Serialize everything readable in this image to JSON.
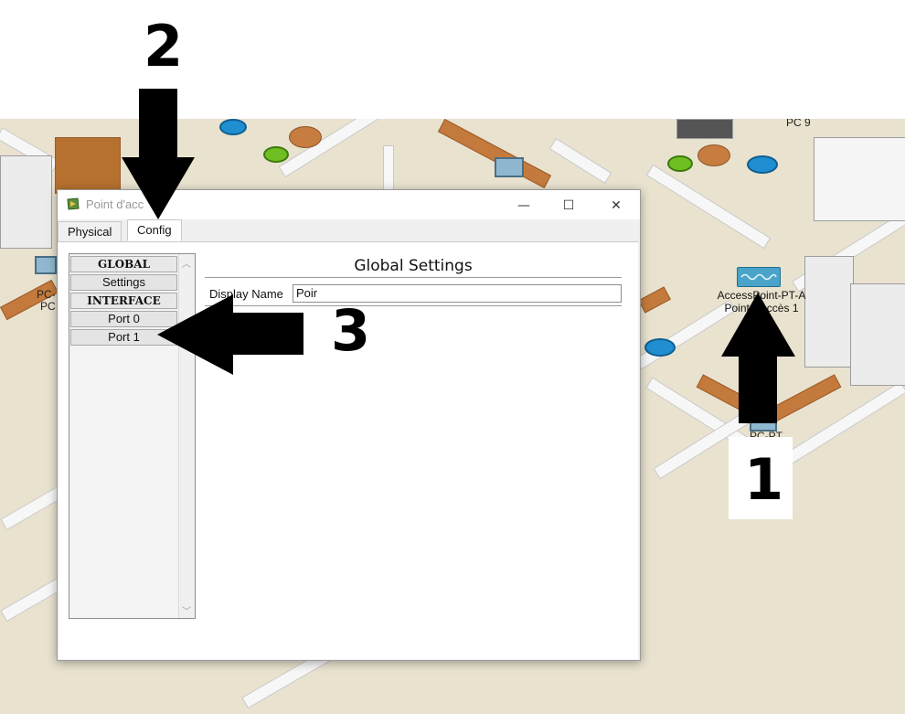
{
  "annotations": {
    "step1": "1",
    "step2": "2",
    "step3": "3"
  },
  "workspace": {
    "pc_labels": [
      "PC 9",
      "PC-",
      "PC",
      "PC-PT"
    ],
    "access_point": {
      "line1": "AccessPoint-PT-A",
      "line2": "Point d'accès 1"
    }
  },
  "window": {
    "title": "Point d'acc",
    "controls": {
      "minimize": "—",
      "maximize": "☐",
      "close": "✕"
    },
    "tabs": [
      {
        "label": "Physical"
      },
      {
        "label": "Config"
      }
    ],
    "active_tab": "Config",
    "sidebar": {
      "items": [
        {
          "label": "GLOBAL",
          "type": "header"
        },
        {
          "label": "Settings",
          "type": "item"
        },
        {
          "label": "INTERFACE",
          "type": "header"
        },
        {
          "label": "Port 0",
          "type": "item"
        },
        {
          "label": "Port 1",
          "type": "item"
        }
      ]
    },
    "panel": {
      "title": "Global Settings",
      "display_name_label": "Display Name",
      "display_name_value": "Poir"
    }
  },
  "colors": {
    "arrow": "#000000",
    "floor": "#e9e2cf",
    "window_bg": "#f0f0f0"
  }
}
